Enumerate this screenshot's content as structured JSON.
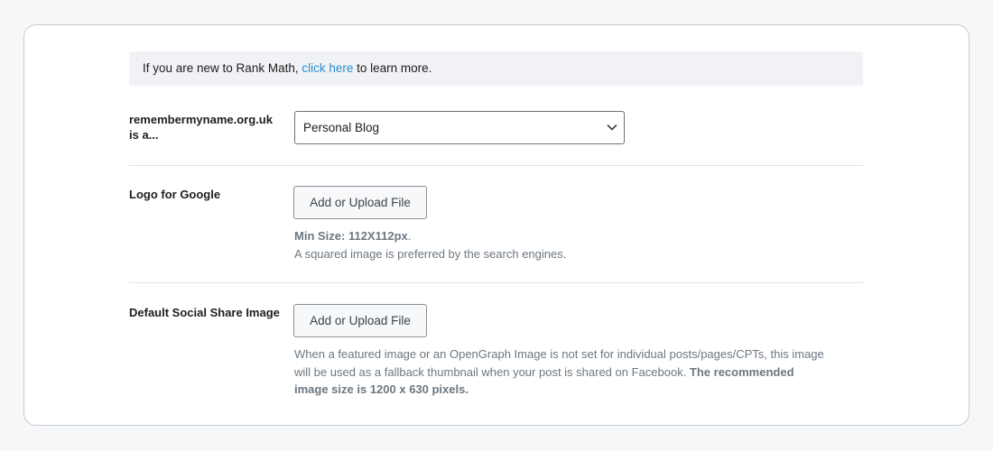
{
  "notice": {
    "prefix": "If you are new to Rank Math, ",
    "link": "click here",
    "suffix": " to learn more."
  },
  "site_type": {
    "label_line1": "remembermyname.org.uk",
    "label_line2": "is a...",
    "selected": "Personal Blog"
  },
  "logo": {
    "label": "Logo for Google",
    "button": "Add or Upload File",
    "min_size": "Min Size: 112X112px",
    "min_size_end": ".",
    "hint": "A squared image is preferred by the search engines."
  },
  "social": {
    "label": "Default Social Share Image",
    "button": "Add or Upload File",
    "desc_line1": "When a featured image or an OpenGraph Image is not set for individual posts/pages/CPTs, this image",
    "desc_line2": "will be used as a fallback thumbnail when your post is shared on Facebook. ",
    "desc_bold2": "The recommended",
    "desc_bold3": "image size is 1200 x 630 pixels."
  },
  "colors": {
    "link": "#2b8ed0",
    "notice_bg": "#f0f2f5",
    "muted_text": "#6c7781"
  },
  "icons": {
    "select_arrow": "chevron-down-icon"
  }
}
